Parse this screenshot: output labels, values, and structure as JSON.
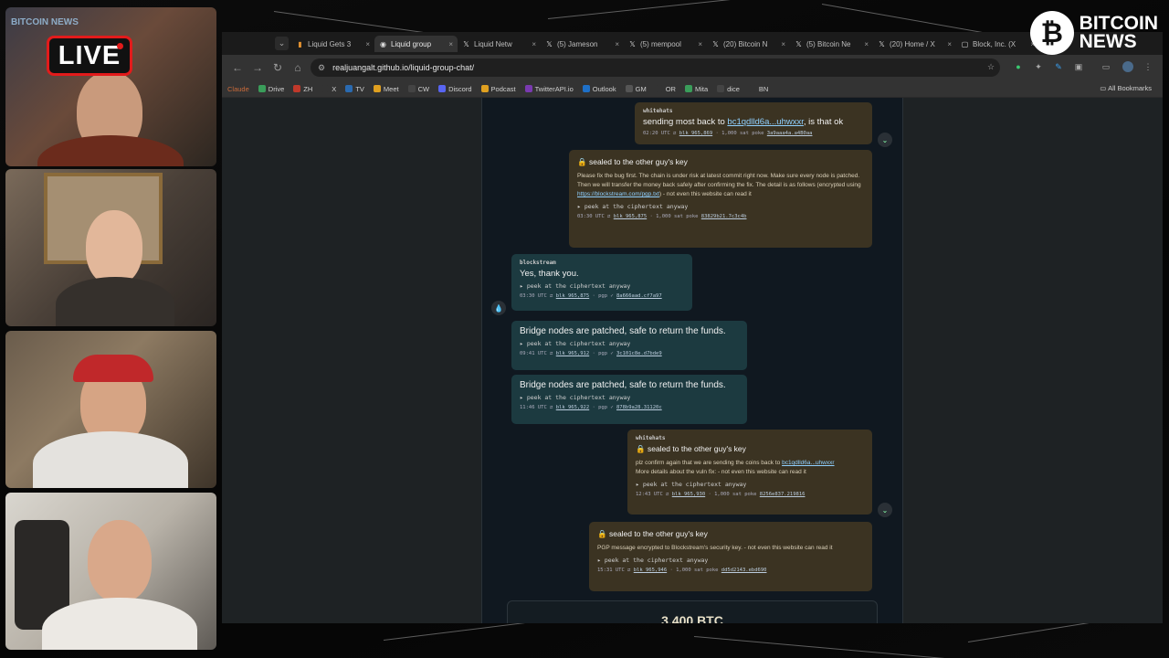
{
  "overlay": {
    "live_label": "LIVE",
    "brand_line1": "BITCOIN",
    "brand_line2": "NEWS",
    "coin_symbol": "₿",
    "cam_logo": "BITCOIN NEWS"
  },
  "browser": {
    "tabs": [
      {
        "label": "Liquid Gets 3",
        "icon": "bookmark-icon",
        "active": false
      },
      {
        "label": "Liquid group",
        "icon": "github-icon",
        "active": true
      },
      {
        "label": "Liquid Netw",
        "icon": "x-icon",
        "active": false
      },
      {
        "label": "(5) Jameson",
        "icon": "x-icon",
        "active": false
      },
      {
        "label": "(5) mempool",
        "icon": "x-icon",
        "active": false
      },
      {
        "label": "(20) Bitcoin N",
        "icon": "x-icon",
        "active": false
      },
      {
        "label": "(5) Bitcoin Ne",
        "icon": "x-icon",
        "active": false
      },
      {
        "label": "(20) Home / X",
        "icon": "x-icon",
        "active": false
      },
      {
        "label": "Block, Inc. (X",
        "icon": "block-icon",
        "active": false
      }
    ],
    "url": "realjuangalt.github.io/liquid-group-chat/",
    "bookmarks": [
      {
        "label": "Claude",
        "color": "#c96a3a"
      },
      {
        "label": "Drive",
        "color": "#3a9d5a"
      },
      {
        "label": "ZH",
        "color": "#c0392b"
      },
      {
        "label": "X",
        "color": "#333333"
      },
      {
        "label": "TV",
        "color": "#2a6ab0"
      },
      {
        "label": "Meet",
        "color": "#e0a020"
      },
      {
        "label": "CW",
        "color": "#444444"
      },
      {
        "label": "Discord",
        "color": "#5865f2"
      },
      {
        "label": "Podcast",
        "color": "#e0a020"
      },
      {
        "label": "TwitterAPI.io",
        "color": "#7a3ab0"
      },
      {
        "label": "Outlook",
        "color": "#1e70c8"
      },
      {
        "label": "GM",
        "color": "#555555"
      },
      {
        "label": "OR",
        "color": "#333333"
      },
      {
        "label": "Mita",
        "color": "#3a9d5a"
      },
      {
        "label": "dice",
        "color": "#444444"
      },
      {
        "label": "BN",
        "color": "#333333"
      }
    ],
    "all_bookmarks": "All Bookmarks"
  },
  "chat": {
    "msg1": {
      "sender": "whitehats",
      "text": "sending most back to",
      "link": "bc1qdlld6a...uhwxxr",
      "text_after": ", is that ok",
      "time": "02:20 UTC",
      "blk": "blk 965,869",
      "extra": "1,000 sat poke",
      "hash": "3a9aaa4a.a4B0aa"
    },
    "msg2": {
      "sealed": "sealed to the other guy's key",
      "body": "Please fix the bug first. The chain is under risk at latest commit right now. Make sure every node is patched. Then we will transfer the money back safely after confirming the fix. The detail is as follows (encrypted using",
      "link": "https://blockstream.com/pgp.txt",
      "body_after": ") - not even this website can read it",
      "peek": "▸ peek at the ciphertext anyway",
      "time": "03:30 UTC",
      "blk": "blk 965,875",
      "extra": "1,000 sat poke",
      "hash": "83829b21.7c3c4b"
    },
    "msg3": {
      "sender": "blockstream",
      "text": "Yes, thank you.",
      "peek": "▸ peek at the ciphertext anyway",
      "time": "03:30 UTC",
      "blk": "blk 965,875",
      "extra": "pgp ✓",
      "hash": "8a666aad.cf7a97"
    },
    "msg4": {
      "text": "Bridge nodes are patched, safe to return the funds.",
      "peek": "▸ peek at the ciphertext anyway",
      "time": "09:41 UTC",
      "blk": "blk 965,912",
      "extra": "pgp ✓",
      "hash": "3c101c8e.d7bde9"
    },
    "msg5": {
      "text": "Bridge nodes are patched, safe to return the funds.",
      "peek": "▸ peek at the ciphertext anyway",
      "time": "11:46 UTC",
      "blk": "blk 965,922",
      "extra": "pgp ✓",
      "hash": "878b9a28.31120c"
    },
    "msg6": {
      "sender": "whitehats",
      "sealed": "sealed to the other guy's key",
      "body": "plz confirm again that we are sending the coins back to",
      "link": "bc1qdlld6a...uhwxxr",
      "body2": "More details about the vuln fix: - not even this website can read it",
      "peek": "▸ peek at the ciphertext anyway",
      "time": "12:43 UTC",
      "blk": "blk 965,930",
      "extra": "1,000 sat poke",
      "hash": "8256e837.219816"
    },
    "msg7": {
      "sealed": "sealed to the other guy's key",
      "body": "PGP message encrypted to Blockstream's security key. - not even this website can read it",
      "peek": "▸ peek at the ciphertext anyway",
      "time": "15:31 UTC",
      "blk": "blk 965,946",
      "extra": "1,000 sat poke",
      "hash": "dd5d2143.ebd690"
    },
    "total": "3,400 BTC"
  }
}
